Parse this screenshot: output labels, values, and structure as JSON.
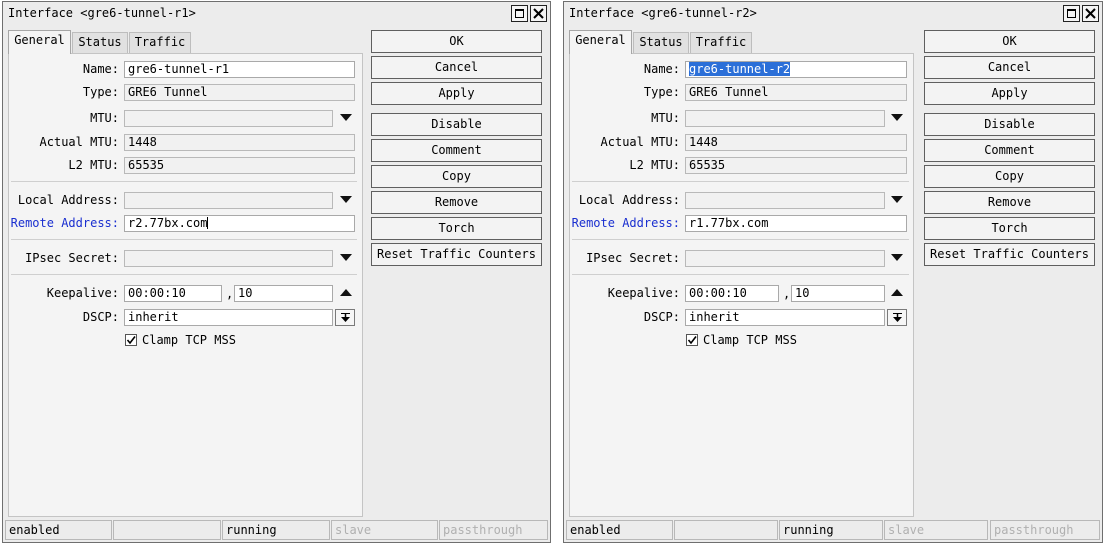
{
  "windows": [
    {
      "title": "Interface <gre6-tunnel-r1>",
      "tabs": [
        "General",
        "Status",
        "Traffic"
      ],
      "form": {
        "name_label": "Name:",
        "name_value": "gre6-tunnel-r1",
        "type_label": "Type:",
        "type_value": "GRE6 Tunnel",
        "mtu_label": "MTU:",
        "mtu_value": "",
        "actual_mtu_label": "Actual MTU:",
        "actual_mtu_value": "1448",
        "l2_mtu_label": "L2 MTU:",
        "l2_mtu_value": "65535",
        "local_address_label": "Local Address:",
        "local_address_value": "",
        "remote_address_label": "Remote Address:",
        "remote_address_value": "r2.77bx.com",
        "ipsec_secret_label": "IPsec Secret:",
        "ipsec_secret_value": "",
        "keepalive_label": "Keepalive:",
        "keepalive_interval": "00:00:10",
        "keepalive_separator": ",",
        "keepalive_retries": "10",
        "dscp_label": "DSCP:",
        "dscp_value": "inherit",
        "clamp_tcp_mss_label": "Clamp TCP MSS",
        "clamp_tcp_mss_checked": true
      },
      "buttons": [
        "OK",
        "Cancel",
        "Apply",
        "Disable",
        "Comment",
        "Copy",
        "Remove",
        "Torch",
        "Reset Traffic Counters"
      ],
      "status": [
        "enabled",
        "",
        "running",
        "slave",
        "passthrough"
      ]
    },
    {
      "title": "Interface <gre6-tunnel-r2>",
      "tabs": [
        "General",
        "Status",
        "Traffic"
      ],
      "form": {
        "name_label": "Name:",
        "name_value": "gre6-tunnel-r2",
        "type_label": "Type:",
        "type_value": "GRE6 Tunnel",
        "mtu_label": "MTU:",
        "mtu_value": "",
        "actual_mtu_label": "Actual MTU:",
        "actual_mtu_value": "1448",
        "l2_mtu_label": "L2 MTU:",
        "l2_mtu_value": "65535",
        "local_address_label": "Local Address:",
        "local_address_value": "",
        "remote_address_label": "Remote Address:",
        "remote_address_value": "r1.77bx.com",
        "ipsec_secret_label": "IPsec Secret:",
        "ipsec_secret_value": "",
        "keepalive_label": "Keepalive:",
        "keepalive_interval": "00:00:10",
        "keepalive_separator": ",",
        "keepalive_retries": "10",
        "dscp_label": "DSCP:",
        "dscp_value": "inherit",
        "clamp_tcp_mss_label": "Clamp TCP MSS",
        "clamp_tcp_mss_checked": true
      },
      "buttons": [
        "OK",
        "Cancel",
        "Apply",
        "Disable",
        "Comment",
        "Copy",
        "Remove",
        "Torch",
        "Reset Traffic Counters"
      ],
      "status": [
        "enabled",
        "",
        "running",
        "slave",
        "passthrough"
      ]
    }
  ],
  "colors": {
    "window_bg": "#ececec",
    "panel_bg": "#f4f4f4",
    "remote_label_color": "#1a2fd0",
    "selection": "#2b6fd8",
    "disabled_text": "#b0b0b0"
  }
}
